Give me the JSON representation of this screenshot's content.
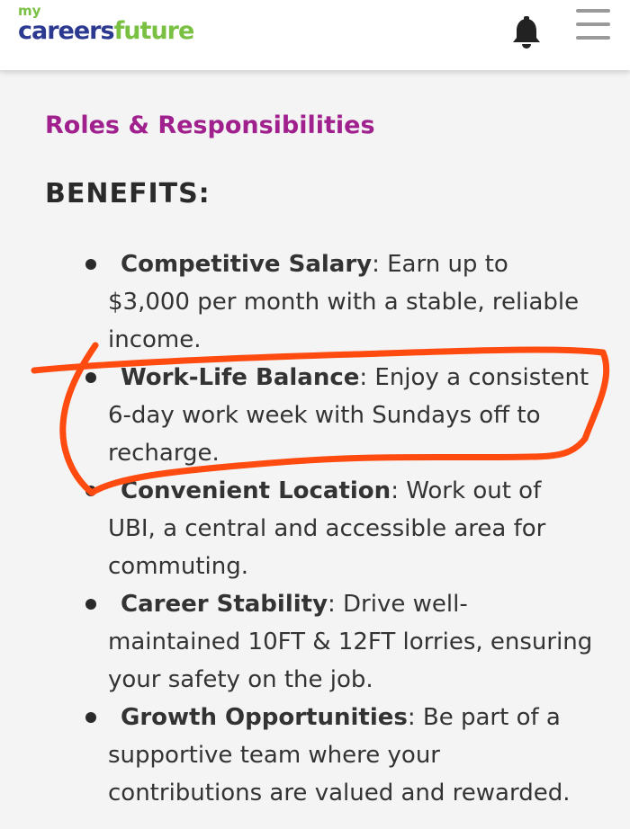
{
  "header": {
    "logo": {
      "my": "my",
      "careers": "careers",
      "future": "future"
    },
    "bell_icon": "bell-icon",
    "menu_icon": "hamburger-menu-icon"
  },
  "content": {
    "section_link": "Roles & Responsibilities",
    "benefits_heading": "BENEFITS:",
    "benefits": [
      {
        "title": "Competitive Salary",
        "text": ": Earn up to $3,000 per month with a stable, reliable income."
      },
      {
        "title": "Work-Life Balance",
        "text": ": Enjoy a consistent 6-day work week with Sundays off to recharge."
      },
      {
        "title": "Convenient Location",
        "text": ": Work out of UBI, a central and accessible area for commuting."
      },
      {
        "title": "Career Stability",
        "text": ": Drive well-maintained 10FT & 12FT lorries, ensuring your safety on the job."
      },
      {
        "title": "Growth Opportunities",
        "text": ": Be part of a supportive team where your contributions are valued and rewarded."
      }
    ]
  },
  "colors": {
    "brand_blue": "#2b3990",
    "brand_green": "#7ac143",
    "section_link": "#a0218e",
    "annotation": "#ff4a10"
  }
}
